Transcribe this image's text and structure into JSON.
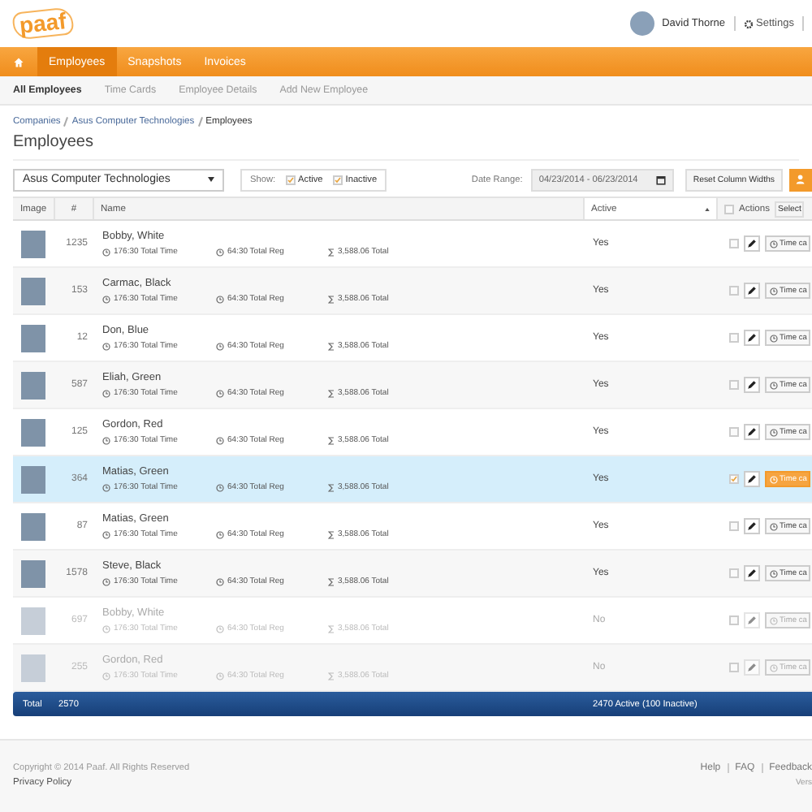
{
  "header": {
    "logo": "paaf",
    "user": {
      "name": "David Thorne"
    },
    "settings": "Settings"
  },
  "nav": [
    {
      "label": "Employees",
      "selected": true
    },
    {
      "label": "Snapshots",
      "selected": false
    },
    {
      "label": "Invoices",
      "selected": false
    }
  ],
  "subnav": [
    {
      "label": "All Employees",
      "selected": true
    },
    {
      "label": "Time Cards",
      "selected": false
    },
    {
      "label": "Employee Details",
      "selected": false
    },
    {
      "label": "Add New Employee",
      "selected": false
    }
  ],
  "breadcrumb": [
    "Companies",
    "Asus Computer Technologies",
    "Employees"
  ],
  "title": "Employees",
  "toolbar": {
    "company": "Asus Computer Technologies",
    "show_label": "Show:",
    "filters": [
      {
        "label": "Active",
        "checked": true
      },
      {
        "label": "Inactive",
        "checked": true
      }
    ],
    "date_label": "Date Range:",
    "date_value": "04/23/2014 - 06/23/2014",
    "reset_button": "Reset Column Widths"
  },
  "table": {
    "columns": [
      "Image",
      "#",
      "Name",
      "Active",
      "Actions"
    ],
    "select_button": "Select",
    "select_all_checked": false,
    "rows": [
      {
        "number": "1235",
        "name": "Bobby, White",
        "total_time": "176:30 Total Time",
        "total_reg": "64:30 Total Reg",
        "total": "3,588.06 Total",
        "active_text": "Yes",
        "active": true,
        "selected": false,
        "action_label": "Time ca"
      },
      {
        "number": "153",
        "name": "Carmac, Black",
        "total_time": "176:30 Total Time",
        "total_reg": "64:30 Total Reg",
        "total": "3,588.06 Total",
        "active_text": "Yes",
        "active": true,
        "selected": false,
        "action_label": "Time ca"
      },
      {
        "number": "12",
        "name": "Don, Blue",
        "total_time": "176:30 Total Time",
        "total_reg": "64:30 Total Reg",
        "total": "3,588.06 Total",
        "active_text": "Yes",
        "active": true,
        "selected": false,
        "action_label": "Time ca"
      },
      {
        "number": "587",
        "name": "Eliah, Green",
        "total_time": "176:30 Total Time",
        "total_reg": "64:30 Total Reg",
        "total": "3,588.06 Total",
        "active_text": "Yes",
        "active": true,
        "selected": false,
        "action_label": "Time ca"
      },
      {
        "number": "125",
        "name": "Gordon, Red",
        "total_time": "176:30 Total Time",
        "total_reg": "64:30 Total Reg",
        "total": "3,588.06 Total",
        "active_text": "Yes",
        "active": true,
        "selected": false,
        "action_label": "Time ca"
      },
      {
        "number": "364",
        "name": "Matias, Green",
        "total_time": "176:30 Total Time",
        "total_reg": "64:30 Total Reg",
        "total": "3,588.06 Total",
        "active_text": "Yes",
        "active": true,
        "selected": true,
        "action_label": "Time ca"
      },
      {
        "number": "87",
        "name": "Matias, Green",
        "total_time": "176:30 Total Time",
        "total_reg": "64:30 Total Reg",
        "total": "3,588.06 Total",
        "active_text": "Yes",
        "active": true,
        "selected": false,
        "action_label": "Time ca"
      },
      {
        "number": "1578",
        "name": "Steve, Black",
        "total_time": "176:30 Total Time",
        "total_reg": "64:30 Total Reg",
        "total": "3,588.06 Total",
        "active_text": "Yes",
        "active": true,
        "selected": false,
        "action_label": "Time ca"
      },
      {
        "number": "697",
        "name": "Bobby, White",
        "total_time": "176:30 Total Time",
        "total_reg": "64:30 Total Reg",
        "total": "3,588.06 Total",
        "active_text": "No",
        "active": false,
        "selected": false,
        "action_label": "Time ca"
      },
      {
        "number": "255",
        "name": "Gordon, Red",
        "total_time": "176:30 Total Time",
        "total_reg": "64:30 Total Reg",
        "total": "3,588.06 Total",
        "active_text": "No",
        "active": false,
        "selected": false,
        "action_label": "Time ca"
      }
    ],
    "total_row": {
      "label": "Total",
      "count": "2570",
      "summary": "2470 Active (100 Inactive)"
    }
  },
  "footer": {
    "copyright": "Copyright © 2014 Paaf. All Rights Reserved",
    "privacy": "Privacy Policy",
    "links": [
      "Help",
      "FAQ",
      "Feedback"
    ],
    "version": "Vers"
  }
}
